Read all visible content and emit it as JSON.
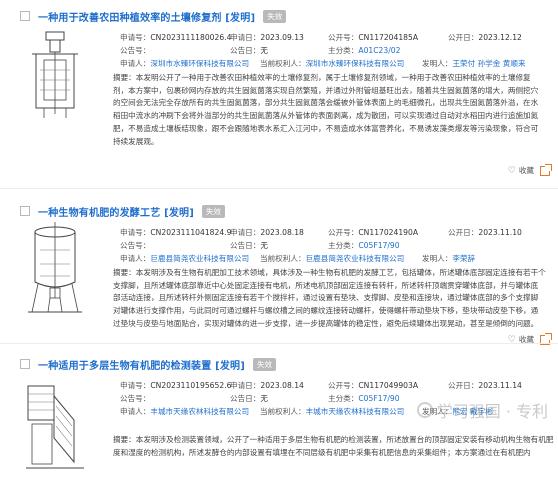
{
  "records": [
    {
      "title": "一种用于改善农田种植效率的土壤修复剂 [发明]",
      "status": "失效",
      "app_no_label": "申请号：",
      "app_no": "CN2023111180026.4",
      "app_date_label": "申请日：",
      "app_date": "2023.09.13",
      "pub_no_label": "公开号：",
      "pub_no": "CN117204185A",
      "pub_date_label": "公开日：",
      "pub_date": "2023.12.12",
      "grant_no_label": "公告号：",
      "grant_no": "",
      "grant_date_label": "公告日：",
      "grant_date": "无",
      "ipc_label": "主分类：",
      "ipc": "A01C23/02",
      "applicant_label": "申请人：",
      "applicant": "深圳市水臻环保科技有限公司",
      "holder_label": "当前权利人：",
      "holder": "深圳市水臻环保科技有限公司",
      "inventor_label": "发明人：",
      "inventors": "王荣付 孙学金 黄顺来",
      "abstract": [
        "摘要：本发明公开了一种用于改善农田种植效率的土壤修复剂，属于土壤修复剂领域，一种用于改善农田种植效率的土壤修复",
        "剂，本方案中，包裹砂网内存放的共生固氮菌落实现自然繁殖，并通过外附管组基旺出去，随着共生固氮菌落的增大，两侧挖穴",
        "的空间会无法完全存放所有的共生固氮菌落，部分共生固氮菌落会缓被外管体表面上的毛细微孔，出现共生固氮菌落外溢，在水",
        "稻田中流水的冲刷下会将外溢部分的共生固氮菌落从外管体的表面剥离，成为散团，可以实现通过自动对水稻田内进行追施加氮",
        "肥，不易造成土壤板结现象，跟不会跟随地表水系汇入江河中，不易造成水体富营养化，不易诱发藻类爆发等污染现象，符合可",
        "持续发展观。"
      ],
      "favorite_label": "收藏"
    },
    {
      "title": "一种生物有机肥的发酵工艺 [发明]",
      "status": "失效",
      "app_no_label": "申请号：",
      "app_no": "CN2023111041824.9",
      "app_date_label": "申请日：",
      "app_date": "2023.08.18",
      "pub_no_label": "公开号：",
      "pub_no": "CN117024190A",
      "pub_date_label": "公开日：",
      "pub_date": "2023.11.10",
      "grant_no_label": "公告号：",
      "grant_no": "",
      "grant_date_label": "公告日：",
      "grant_date": "无",
      "ipc_label": "主分类：",
      "ipc": "C05F17/90",
      "applicant_label": "申请人：",
      "applicant": "巨鹿县简尧农业科技有限公司",
      "holder_label": "当前权利人：",
      "holder": "巨鹿县简尧农业科技有限公司",
      "inventor_label": "发明人：",
      "inventors": "李荣辞",
      "abstract": [
        "摘要：本发明涉及有生物有机肥加工技术领域，具体涉及一种生物有机肥的发酵工艺，包括罐体，所述罐体底部固定连接有若干个",
        "支撑脚，且所述罐体底部靠近中心处固定连接有电机，所述电机顶部固定连接有转杆，所述转杆顶端贯穿罐体底部，并与罐体底",
        "部活动连接，且所述转杆外侧固定连接有若干个搅拌杆，通过设置有垫块、支撑脚、皮垫和连接块，通过罐体底部的多个支撑脚",
        "对罐体进行支撑作用，与此同时可通过螺杆与螺纹槽之间的螺纹连接转动螺杆，使得螺杆带动垫块下移，垫块带动皮垫下移，通",
        "过垫块与皮垫与地面贴合，实现对罐体的进一步支撑，进一步提高罐体的稳定性，避免后续罐体出现晃动，甚至是倾倒的问题。"
      ],
      "favorite_label": "收藏"
    },
    {
      "title": "一种适用于多层生物有机肥的检测装置 [发明]",
      "status": "失效",
      "app_no_label": "申请号：",
      "app_no": "CN2023110195652.6",
      "app_date_label": "申请日：",
      "app_date": "2023.08.14",
      "pub_no_label": "公开号：",
      "pub_no": "CN117049903A",
      "pub_date_label": "公开日：",
      "pub_date": "2023.11.14",
      "grant_no_label": "公告号：",
      "grant_no": "",
      "grant_date_label": "公告日：",
      "grant_date": "无",
      "ipc_label": "主分类：",
      "ipc": "C05F17/90",
      "applicant_label": "申请人：",
      "applicant": "丰城市天缘农林科技有限公司",
      "holder_label": "当前权利人：",
      "holder": "丰城市天缘农林科技有限公司",
      "inventor_label": "发明人：",
      "inventors": "熊宏 戴宇彬",
      "abstract": [
        "摘要：本发明涉及检测装置领域，公开了一种适用于多层生物有机肥的检测装置，所述放置台的顶部固定安装有移动机构生物有机肥",
        "度和湿度的检测机构，所述发酵仓的内部设置有填埋在不同层级有机肥中采集有机肥信息的采集组件；本方案通过在有机肥内"
      ]
    }
  ],
  "watermark": "学习强国 · 专利"
}
